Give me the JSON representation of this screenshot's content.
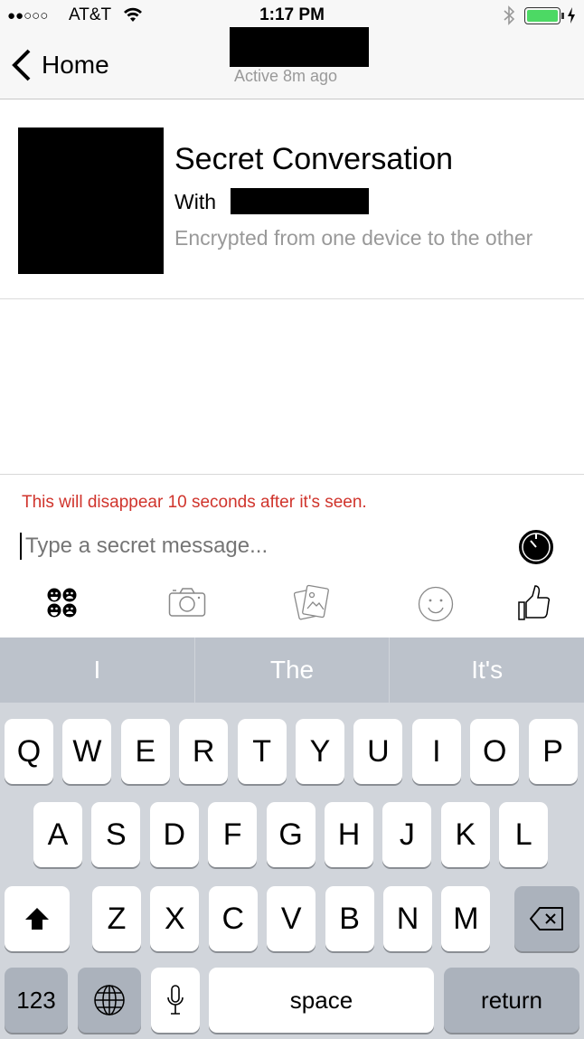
{
  "status_bar": {
    "signal": "●●○○○",
    "carrier": "AT&T",
    "time": "1:17 PM",
    "battery_color": "#4cd964"
  },
  "nav": {
    "back_label": "Home",
    "subtitle": "Active 8m ago"
  },
  "header": {
    "title": "Secret Conversation",
    "with_label": "With",
    "subtitle": "Encrypted from one device to the other"
  },
  "composer": {
    "notice": "This will disappear 10 seconds after it's seen.",
    "notice_color": "#d0342c",
    "placeholder": "Type a secret message...",
    "toolbar": [
      "stickers-icon",
      "camera-icon",
      "photos-icon",
      "emoji-icon",
      "like-icon"
    ]
  },
  "keyboard": {
    "suggestions": [
      "I",
      "The",
      "It's"
    ],
    "row1": [
      "Q",
      "W",
      "E",
      "R",
      "T",
      "Y",
      "U",
      "I",
      "O",
      "P"
    ],
    "row2": [
      "A",
      "S",
      "D",
      "F",
      "G",
      "H",
      "J",
      "K",
      "L"
    ],
    "row3": [
      "Z",
      "X",
      "C",
      "V",
      "B",
      "N",
      "M"
    ],
    "numbers_label": "123",
    "space_label": "space",
    "return_label": "return"
  }
}
